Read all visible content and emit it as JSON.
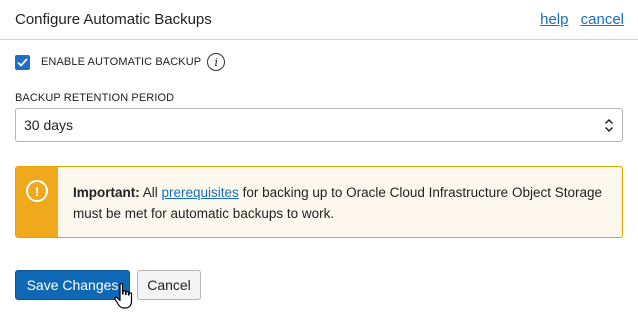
{
  "header": {
    "title": "Configure Automatic Backups",
    "help_link": "help",
    "cancel_link": "cancel"
  },
  "enable_backup": {
    "checked": true,
    "label": "ENABLE AUTOMATIC BACKUP",
    "info_icon": "info-icon",
    "info_glyph": "i"
  },
  "retention": {
    "label": "BACKUP RETENTION PERIOD",
    "selected": "30 days"
  },
  "alert": {
    "icon": "warning-icon",
    "icon_glyph": "!",
    "strong": "Important:",
    "text_before": " All ",
    "link": "prerequisites",
    "text_after": " for backing up to Oracle Cloud Infrastructure Object Storage must be met for automatic backups to work.",
    "bar_color": "#f0a81c"
  },
  "buttons": {
    "save_label": "Save Changes",
    "cancel_label": "Cancel"
  },
  "colors": {
    "primary": "#0f68b3",
    "link": "#1a6fbf",
    "warning": "#f0a81c"
  }
}
